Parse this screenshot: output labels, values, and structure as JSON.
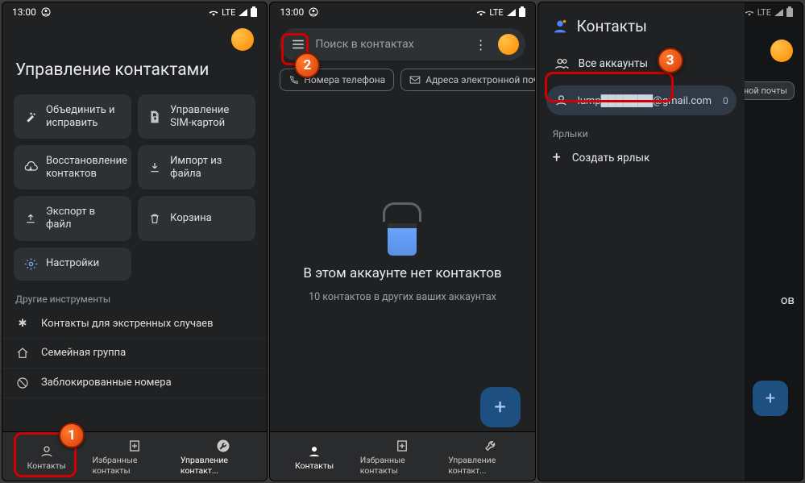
{
  "status": {
    "time": "13:00",
    "net": "LTE"
  },
  "s1": {
    "title": "Управление контактами",
    "tiles": {
      "combine": "Объединить и исправить",
      "sim": "Управление SIM-картой",
      "restore": "Восстановление контактов",
      "import": "Импорт из файла",
      "export": "Экспорт в файл",
      "trash": "Корзина",
      "settings": "Настройки"
    },
    "other_h": "Другие инструменты",
    "rows": {
      "emergency": "Контакты для экстренных случаев",
      "family": "Семейная группа",
      "blocked": "Заблокированные номера"
    }
  },
  "nav": {
    "contacts": "Контакты",
    "fav": "Избранные контакты",
    "manage": "Управление контакт..."
  },
  "s2": {
    "search_placeholder": "Поиск в контактах",
    "chip_phone": "Номера телефона",
    "chip_email": "Адреса электронной почты",
    "empty_title": "В этом аккаунте нет контактов",
    "empty_sub": "10 контактов в других ваших аккаунтах"
  },
  "s3": {
    "drawer_title": "Контакты",
    "all_accounts": "Все аккаунты",
    "account_email": "lump███████@gmail.com",
    "account_count": "0",
    "labels_h": "Ярлыки",
    "create_label": "Создать ярлык",
    "bg_chip": "ной почты",
    "bg_txt": "ов"
  },
  "markers": {
    "m1": "1",
    "m2": "2",
    "m3": "3"
  }
}
